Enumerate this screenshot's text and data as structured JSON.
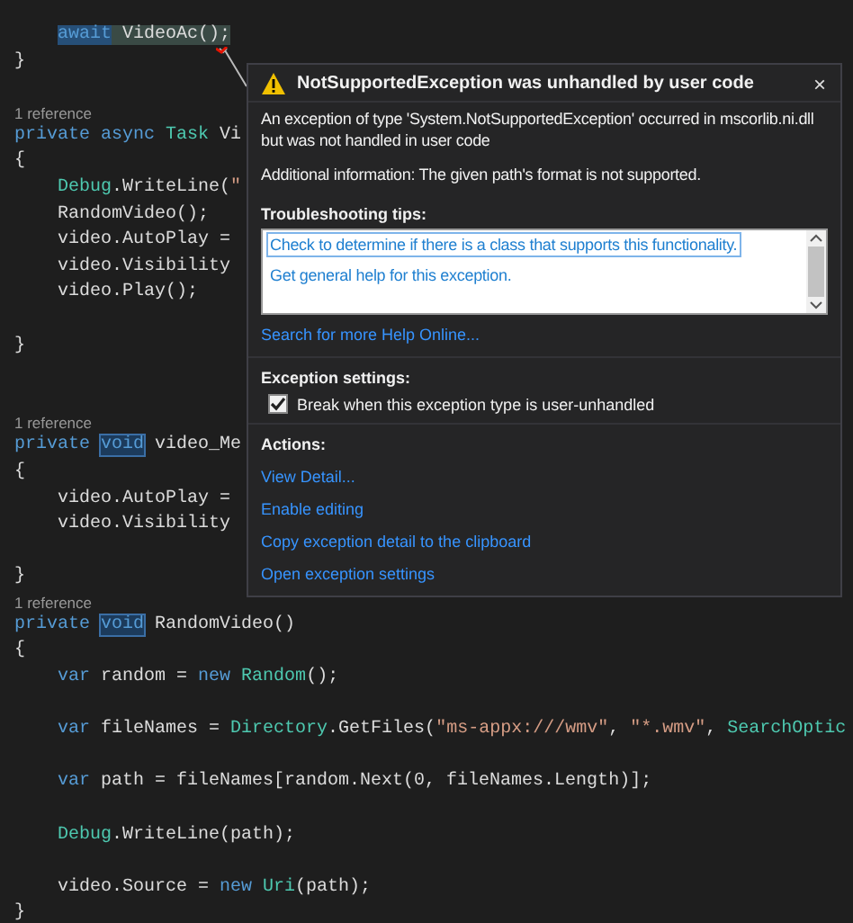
{
  "editor": {
    "lines": [
      {
        "kind": "code-indented",
        "tokens": [
          {
            "t": "await",
            "kind": "kw-sel"
          },
          {
            "t": " VideoAc();",
            "kind": "sel"
          }
        ]
      },
      {
        "kind": "code",
        "tokens": [
          {
            "t": "}",
            "kind": "plain"
          }
        ]
      },
      {
        "kind": "blank"
      },
      {
        "kind": "ref",
        "text": "1 reference"
      },
      {
        "kind": "code",
        "tokens": [
          {
            "t": "private async ",
            "kind": "kw"
          },
          {
            "t": "Task",
            "kind": "type"
          },
          {
            "t": " Vi",
            "kind": "plain"
          }
        ]
      },
      {
        "kind": "code",
        "tokens": [
          {
            "t": "{",
            "kind": "plain"
          }
        ]
      },
      {
        "kind": "code-indented",
        "tokens": [
          {
            "t": "Debug",
            "kind": "type"
          },
          {
            "t": ".WriteLine(",
            "kind": "plain"
          },
          {
            "t": "\"",
            "kind": "str"
          }
        ]
      },
      {
        "kind": "code-indented",
        "tokens": [
          {
            "t": "RandomVideo();",
            "kind": "plain"
          }
        ]
      },
      {
        "kind": "code-indented",
        "tokens": [
          {
            "t": "video.AutoPlay =",
            "kind": "plain"
          }
        ]
      },
      {
        "kind": "code-indented",
        "tokens": [
          {
            "t": "video.Visibility",
            "kind": "plain"
          }
        ]
      },
      {
        "kind": "code-indented",
        "tokens": [
          {
            "t": "video.Play();",
            "kind": "plain"
          }
        ]
      },
      {
        "kind": "blank"
      },
      {
        "kind": "code",
        "tokens": [
          {
            "t": "}",
            "kind": "plain"
          }
        ]
      },
      {
        "kind": "blank"
      },
      {
        "kind": "blank"
      },
      {
        "kind": "ref",
        "text": "1 reference"
      },
      {
        "kind": "code",
        "tokens": [
          {
            "t": "private ",
            "kind": "kw"
          },
          {
            "t": "void",
            "kind": "kw-box"
          },
          {
            "t": " video_Me",
            "kind": "plain"
          }
        ]
      },
      {
        "kind": "code",
        "tokens": [
          {
            "t": "{",
            "kind": "plain"
          }
        ]
      },
      {
        "kind": "code-indented",
        "tokens": [
          {
            "t": "video.AutoPlay =",
            "kind": "plain"
          }
        ]
      },
      {
        "kind": "code-indented",
        "tokens": [
          {
            "t": "video.Visibility",
            "kind": "plain"
          }
        ]
      },
      {
        "kind": "blank"
      },
      {
        "kind": "code",
        "tokens": [
          {
            "t": "}",
            "kind": "plain"
          }
        ]
      },
      {
        "kind": "ref",
        "text": "1 reference"
      },
      {
        "kind": "code",
        "tokens": [
          {
            "t": "private ",
            "kind": "kw"
          },
          {
            "t": "void",
            "kind": "kw-box"
          },
          {
            "t": " RandomVideo()",
            "kind": "plain"
          }
        ]
      },
      {
        "kind": "code",
        "tokens": [
          {
            "t": "{",
            "kind": "plain"
          }
        ]
      },
      {
        "kind": "code-indented",
        "tokens": [
          {
            "t": "var",
            "kind": "kw"
          },
          {
            "t": " random = ",
            "kind": "plain"
          },
          {
            "t": "new ",
            "kind": "kw"
          },
          {
            "t": "Random",
            "kind": "type"
          },
          {
            "t": "();",
            "kind": "plain"
          }
        ]
      },
      {
        "kind": "blank"
      },
      {
        "kind": "code-indented",
        "tokens": [
          {
            "t": "var",
            "kind": "kw"
          },
          {
            "t": " fileNames = ",
            "kind": "plain"
          },
          {
            "t": "Directory",
            "kind": "type"
          },
          {
            "t": ".GetFiles(",
            "kind": "plain"
          },
          {
            "t": "\"ms-appx:///wmv\"",
            "kind": "str"
          },
          {
            "t": ", ",
            "kind": "plain"
          },
          {
            "t": "\"*.wmv\"",
            "kind": "str"
          },
          {
            "t": ", ",
            "kind": "plain"
          },
          {
            "t": "SearchOptic",
            "kind": "type"
          }
        ]
      },
      {
        "kind": "blank"
      },
      {
        "kind": "code-indented",
        "tokens": [
          {
            "t": "var",
            "kind": "kw"
          },
          {
            "t": " path = fileNames[random.Next(0, fileNames.Length)];",
            "kind": "plain"
          }
        ]
      },
      {
        "kind": "blank"
      },
      {
        "kind": "code-indented",
        "tokens": [
          {
            "t": "Debug",
            "kind": "type"
          },
          {
            "t": ".WriteLine(path);",
            "kind": "plain"
          }
        ]
      },
      {
        "kind": "blank"
      },
      {
        "kind": "code-indented",
        "tokens": [
          {
            "t": "video.Source = ",
            "kind": "plain"
          },
          {
            "t": "new ",
            "kind": "kw"
          },
          {
            "t": "Uri",
            "kind": "type"
          },
          {
            "t": "(path);",
            "kind": "plain"
          }
        ]
      },
      {
        "kind": "code",
        "tokens": [
          {
            "t": "}",
            "kind": "plain"
          }
        ]
      }
    ]
  },
  "popup": {
    "title": "NotSupportedException was unhandled by user code",
    "close": "×",
    "message": "An exception of type 'System.NotSupportedException' occurred in mscorlib.ni.dll but was not handled in user code",
    "additional": "Additional information: The given path's format is not supported.",
    "tips_heading": "Troubleshooting tips:",
    "tips": [
      {
        "label": "Check to determine if there is a class that supports this functionality.",
        "selected": true
      },
      {
        "label": "Get general help for this exception.",
        "selected": false
      }
    ],
    "search_link": "Search for more Help Online...",
    "settings_heading": "Exception settings:",
    "break_option": {
      "label": "Break when this exception type is user-unhandled",
      "checked": true
    },
    "actions_heading": "Actions:",
    "actions": [
      "View Detail...",
      "Enable editing",
      "Copy exception detail to the clipboard",
      "Open exception settings"
    ]
  }
}
